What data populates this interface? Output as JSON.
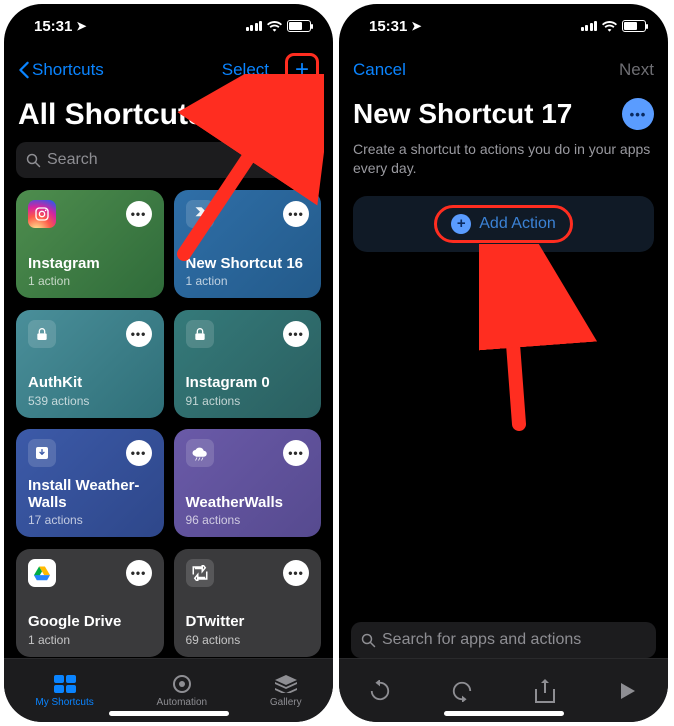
{
  "status": {
    "time": "15:31"
  },
  "left": {
    "back_label": "Shortcuts",
    "select_label": "Select",
    "title": "All Shortcuts",
    "search_placeholder": "Search",
    "tiles": [
      {
        "name": "Instagram",
        "sub": "1 action"
      },
      {
        "name": "New Shortcut 16",
        "sub": "1 action"
      },
      {
        "name": "AuthKit",
        "sub": "539 actions"
      },
      {
        "name": "Instagram 0",
        "sub": "91 actions"
      },
      {
        "name": "Install Weather-Walls",
        "sub": "17 actions"
      },
      {
        "name": "WeatherWalls",
        "sub": "96 actions"
      },
      {
        "name": "Google Drive",
        "sub": "1 action"
      },
      {
        "name": "DTwitter",
        "sub": "69 actions"
      }
    ],
    "tabs": {
      "my": "My Shortcuts",
      "auto": "Automation",
      "gallery": "Gallery"
    }
  },
  "right": {
    "cancel_label": "Cancel",
    "next_label": "Next",
    "title": "New Shortcut 17",
    "subtitle": "Create a shortcut to actions you do in your apps every day.",
    "add_action_label": "Add Action",
    "search_placeholder": "Search for apps and actions"
  }
}
